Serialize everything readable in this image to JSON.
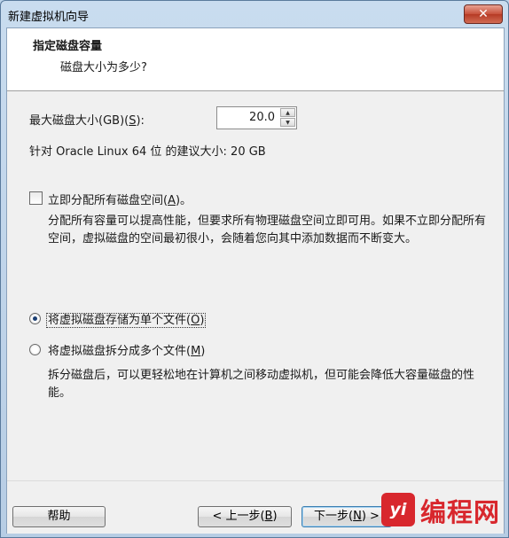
{
  "window": {
    "title": "新建虚拟机向导",
    "close_glyph": "✕"
  },
  "header": {
    "title": "指定磁盘容量",
    "subtitle": "磁盘大小为多少?"
  },
  "disk_size": {
    "label_prefix": "最大磁盘大小(GB)(",
    "label_key": "S",
    "label_suffix": "):",
    "value": "20.0",
    "recommend": "针对 Oracle Linux 64 位 的建议大小: 20 GB"
  },
  "allocate": {
    "label_prefix": "立即分配所有磁盘空间(",
    "label_key": "A",
    "label_suffix": ")。",
    "checked": false,
    "description": "分配所有容量可以提高性能，但要求所有物理磁盘空间立即可用。如果不立即分配所有空间，虚拟磁盘的空间最初很小，会随着您向其中添加数据而不断变大。"
  },
  "storage_options": [
    {
      "label_prefix": "将虚拟磁盘存储为单个文件(",
      "label_key": "O",
      "label_suffix": ")",
      "selected": true
    },
    {
      "label_prefix": "将虚拟磁盘拆分成多个文件(",
      "label_key": "M",
      "label_suffix": ")",
      "selected": false
    }
  ],
  "split_description": "拆分磁盘后，可以更轻松地在计算机之间移动虚拟机，但可能会降低大容量磁盘的性能。",
  "buttons": {
    "help": "帮助",
    "back_prefix": "< 上一步(",
    "back_key": "B",
    "back_suffix": ")",
    "next_prefix": "下一步(",
    "next_key": "N",
    "next_suffix": ") >"
  },
  "watermark": {
    "logo": "yi",
    "text": "编程网"
  }
}
